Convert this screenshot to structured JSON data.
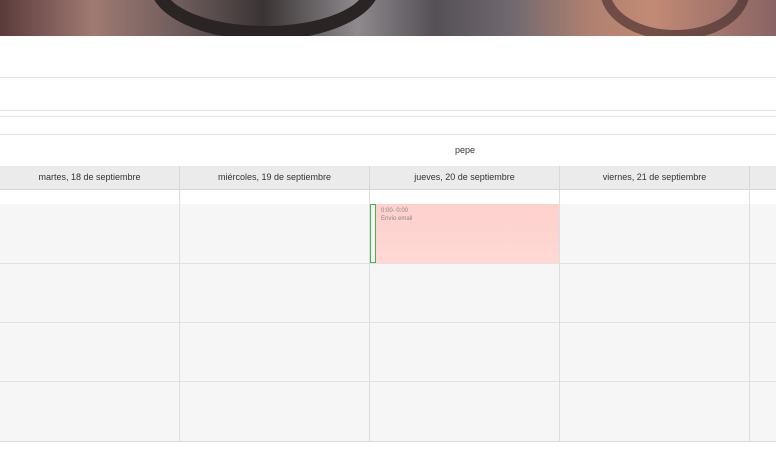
{
  "resource": {
    "name": "pepe"
  },
  "columns": [
    {
      "label": "martes, 18 de septiembre"
    },
    {
      "label": "miércoles, 19 de septiembre"
    },
    {
      "label": "jueves, 20 de septiembre"
    },
    {
      "label": "viernes, 21 de septiembre"
    },
    {
      "label": ""
    }
  ],
  "event": {
    "time": "0:00- 0:00",
    "title": "Envío email",
    "color": "#fdd0cc",
    "marker_color": "#4caf50"
  },
  "colors": {
    "header_bg": "#ebebeb",
    "grid_bg": "#f6f6f6"
  }
}
